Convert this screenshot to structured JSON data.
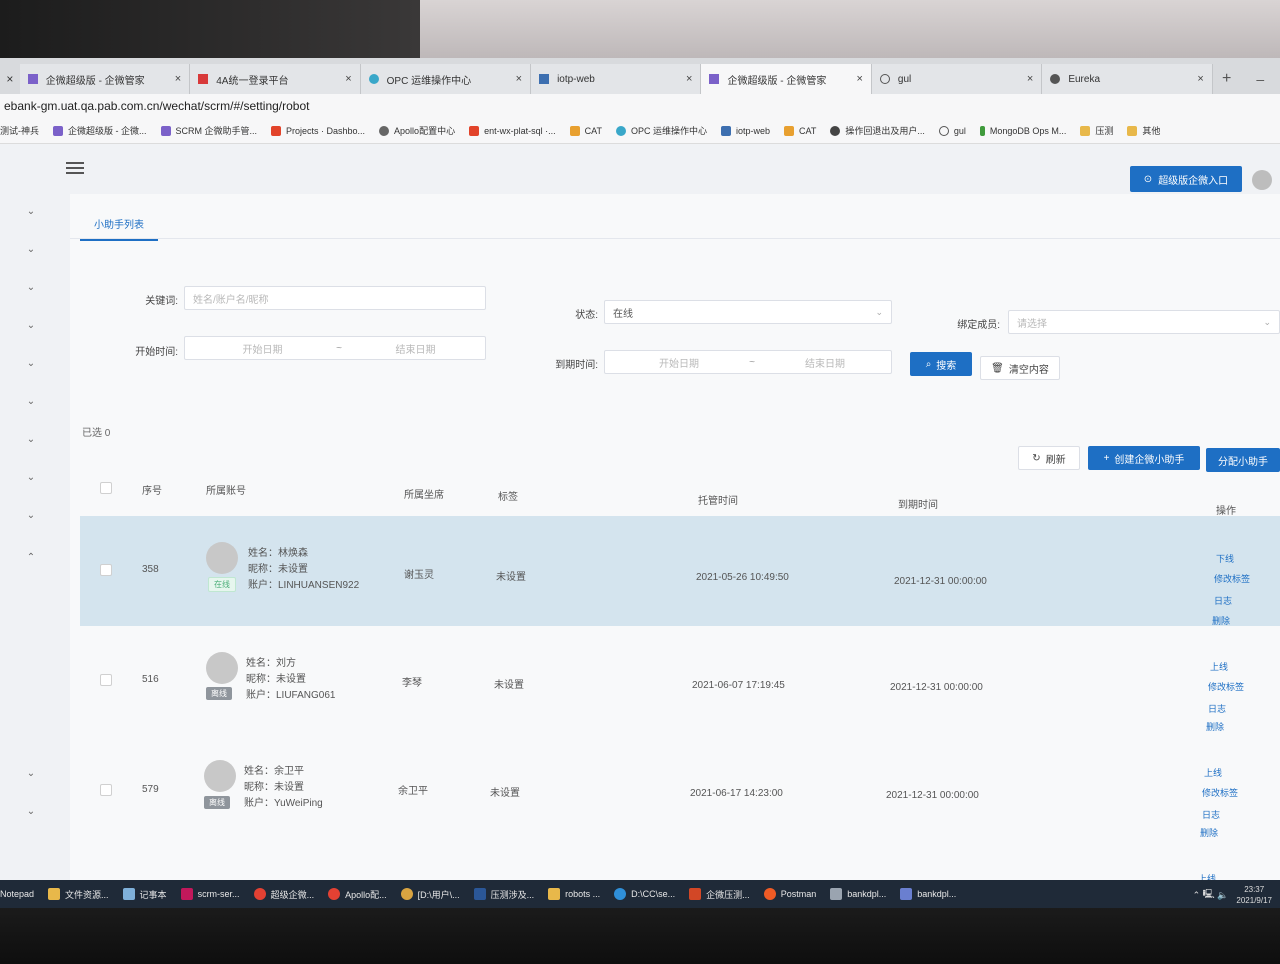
{
  "browser": {
    "tabs": [
      {
        "title": "企微超级版 - 企微管家",
        "active": false
      },
      {
        "title": "4A统一登录平台",
        "active": false
      },
      {
        "title": "OPC 运维操作中心",
        "active": false
      },
      {
        "title": "iotp-web",
        "active": false
      },
      {
        "title": "企微超级版 - 企微管家",
        "active": true
      },
      {
        "title": "gul",
        "active": false
      },
      {
        "title": "Eureka",
        "active": false
      }
    ],
    "url": "ebank-gm.uat.qa.pab.com.cn/wechat/scrm/#/setting/robot",
    "bookmarks": [
      "测试-神兵",
      "企微超级版 - 企微...",
      "SCRM 企微助手管...",
      "Projects · Dashbo...",
      "Apollo配置中心",
      "ent-wx-plat-sql ·...",
      "CAT",
      "OPC 运维操作中心",
      "iotp-web",
      "CAT",
      "操作回退出及用户...",
      "gul",
      "MongoDB Ops M...",
      "压测",
      "其他"
    ]
  },
  "topbar": {
    "enter_button": "超级版企微入口"
  },
  "page_tab": "小助手列表",
  "filters": {
    "keyword_label": "关键词:",
    "keyword_placeholder": "姓名/账户名/昵称",
    "status_label": "状态:",
    "status_value": "在线",
    "bind_label": "绑定成员:",
    "bind_placeholder": "请选择",
    "start_label": "开始时间:",
    "start_from": "开始日期",
    "start_to": "结束日期",
    "expire_label": "到期时间:",
    "expire_from": "开始日期",
    "expire_to": "结束日期",
    "range_sep": "~",
    "search_button": "搜索",
    "clear_button": "清空内容"
  },
  "selected_text": "已选 0",
  "actions": {
    "refresh": "刷新",
    "create": "创建企微小助手",
    "assign": "分配小助手"
  },
  "table": {
    "headers": {
      "seq": "序号",
      "account": "所属账号",
      "seat": "所属坐席",
      "tag": "标签",
      "host_time": "托管时间",
      "expire_time": "到期时间",
      "ops": "操作"
    },
    "rows": [
      {
        "seq": "358",
        "name": "姓名：林焕森",
        "nick": "昵称：未设置",
        "account": "账户：LINHUANSEN922",
        "status": "在线",
        "seat": "谢玉灵",
        "tag": "未设置",
        "host_time": "2021-05-26 10:49:50",
        "expire_time": "2021-12-31 00:00:00",
        "ops": [
          "下线",
          "修改标签",
          "日志",
          "删除"
        ]
      },
      {
        "seq": "516",
        "name": "姓名：刘方",
        "nick": "昵称：未设置",
        "account": "账户：LIUFANG061",
        "status": "离线",
        "seat": "李琴",
        "tag": "未设置",
        "host_time": "2021-06-07 17:19:45",
        "expire_time": "2021-12-31 00:00:00",
        "ops": [
          "上线",
          "修改标签",
          "日志",
          "删除"
        ]
      },
      {
        "seq": "579",
        "name": "姓名：余卫平",
        "nick": "昵称：未设置",
        "account": "账户：YuWeiPing",
        "status": "离线",
        "seat": "余卫平",
        "tag": "未设置",
        "host_time": "2021-06-17 14:23:00",
        "expire_time": "2021-12-31 00:00:00",
        "ops": [
          "上线",
          "修改标签",
          "日志",
          "删除"
        ]
      }
    ],
    "next_row_op": "上线"
  },
  "ime": {
    "lang": "英"
  },
  "taskbar": {
    "items": [
      "Notepad",
      "文件资源...",
      "记事本",
      "scrm-ser...",
      "超级企微...",
      "Apollo配...",
      "[D:\\用户\\...",
      "压测涉及...",
      "robots ...",
      "D:\\CC\\se...",
      "企微压测...",
      "Postman",
      "bankdpl...",
      "bankdpl..."
    ],
    "time": "23:37",
    "date": "2021/9/17"
  },
  "colors": {
    "primary": "#1e6fc4",
    "row_highlight": "#d4e4ee",
    "online_badge": "#4caf7a",
    "offline_badge": "#8f959c"
  }
}
